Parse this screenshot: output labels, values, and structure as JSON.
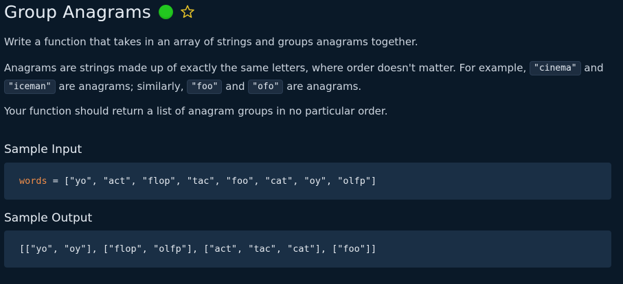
{
  "header": {
    "title": "Group Anagrams",
    "status_color": "#22c71f",
    "status_icon": "solved-status-dot",
    "favorite_icon": "star-outline-icon"
  },
  "description": {
    "p1": "Write a function that takes in an array of strings and groups anagrams together.",
    "p2_part1": "Anagrams are strings made up of exactly the same letters, where order doesn't matter. For example,",
    "p2_code1": "\"cinema\"",
    "p2_part2": "and",
    "p2_code2": "\"iceman\"",
    "p2_part3": "are anagrams; similarly,",
    "p2_code3": "\"foo\"",
    "p2_part4": "and",
    "p2_code4": "\"ofo\"",
    "p2_part5": "are anagrams.",
    "p3": "Your function should return a list of anagram groups in no particular order."
  },
  "sample_input": {
    "heading": "Sample Input",
    "var_name": "words",
    "rest": " = [\"yo\", \"act\", \"flop\", \"tac\", \"foo\", \"cat\", \"oy\", \"olfp\"]"
  },
  "sample_output": {
    "heading": "Sample Output",
    "value": "[[\"yo\", \"oy\"], [\"flop\", \"olfp\"], [\"act\", \"tac\", \"cat\"], [\"foo\"]]"
  },
  "colors": {
    "background": "#0a1928",
    "code_block_bg": "#1a2f45",
    "keyword": "#f08d49",
    "favorite_star": "#e6c229"
  }
}
